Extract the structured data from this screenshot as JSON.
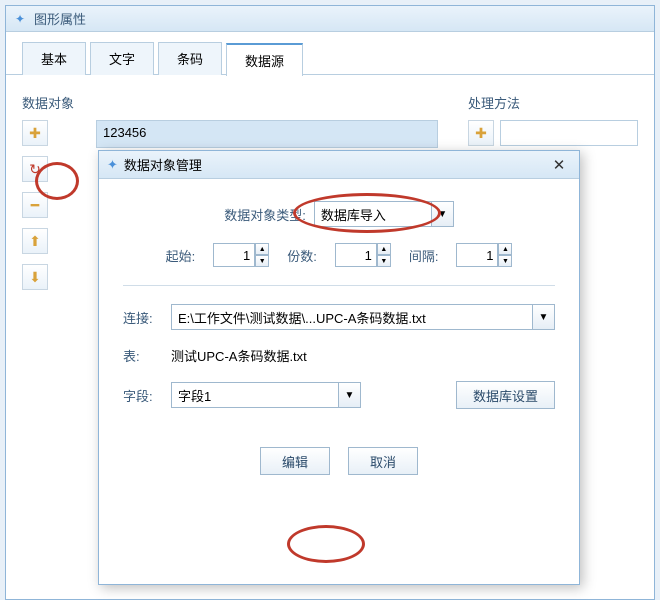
{
  "main": {
    "title": "图形属性",
    "tabs": [
      "基本",
      "文字",
      "条码",
      "数据源"
    ],
    "active_tab": 3,
    "left_panel_title": "数据对象",
    "right_panel_title": "处理方法",
    "data_value": "123456"
  },
  "dialog": {
    "title": "数据对象管理",
    "type_label": "数据对象类型:",
    "type_value": "数据库导入",
    "start_label": "起始:",
    "start_value": "1",
    "copies_label": "份数:",
    "copies_value": "1",
    "interval_label": "间隔:",
    "interval_value": "1",
    "conn_label": "连接:",
    "conn_value": "E:\\工作文件\\测试数据\\...UPC-A条码数据.txt",
    "table_label": "表:",
    "table_value": "测试UPC-A条码数据.txt",
    "field_label": "字段:",
    "field_value": "字段1",
    "db_settings_btn": "数据库设置",
    "edit_btn": "编辑",
    "cancel_btn": "取消"
  }
}
